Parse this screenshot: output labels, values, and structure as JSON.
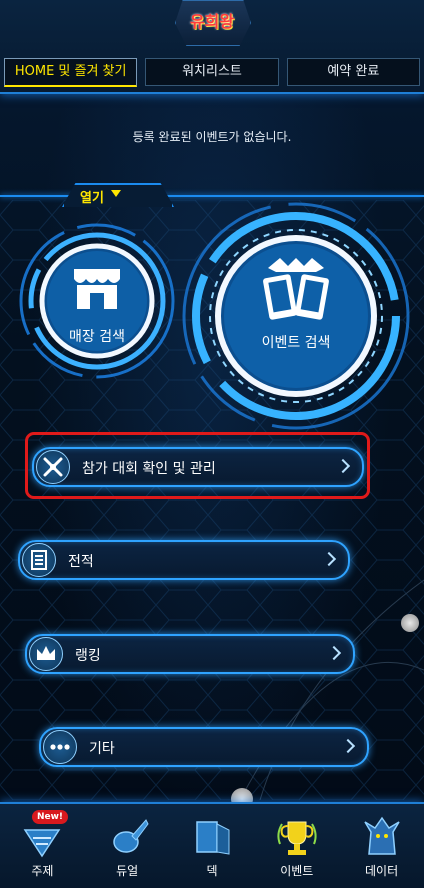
{
  "header": {
    "logo_text": "유희왕",
    "tabs": [
      {
        "label": "HOME 및 즐겨 찾기",
        "active": true
      },
      {
        "label": "워치리스트",
        "active": false
      },
      {
        "label": "예약 완료",
        "active": false
      }
    ]
  },
  "reservations": {
    "empty_message": "등록 완료된 이벤트가 없습니다.",
    "open_label": "열기"
  },
  "search": {
    "store_label": "매장 검색",
    "event_label": "이벤트 검색"
  },
  "menu": {
    "items": [
      {
        "label": "참가 대회 확인 및 관리",
        "icon": "crossed-swords-icon"
      },
      {
        "label": "전적",
        "icon": "record-list-icon"
      },
      {
        "label": "랭킹",
        "icon": "crown-icon"
      },
      {
        "label": "기타",
        "icon": "more-icon"
      }
    ]
  },
  "bottom_nav": {
    "items": [
      {
        "label": "주제",
        "badge": "New!"
      },
      {
        "label": "듀얼"
      },
      {
        "label": "덱"
      },
      {
        "label": "이벤트"
      },
      {
        "label": "데이터"
      }
    ]
  },
  "colors": {
    "accent": "#2fa3ff",
    "active_tab": "#ffe600",
    "highlight": "#e01a1a"
  }
}
